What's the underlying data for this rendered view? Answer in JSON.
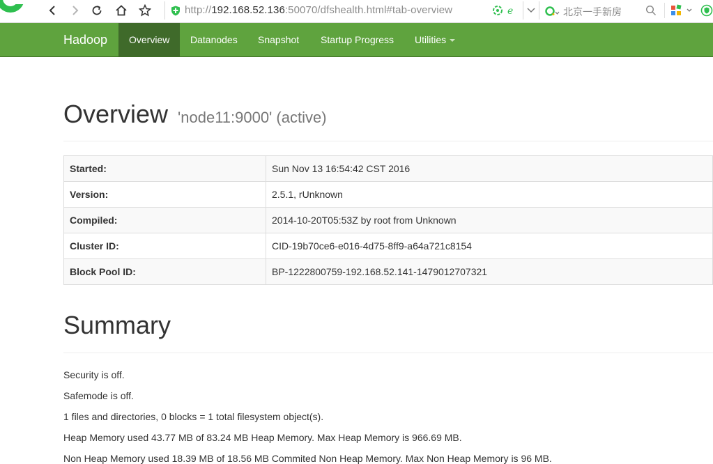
{
  "browser": {
    "url": {
      "scheme": "http://",
      "host": "192.168.52.136",
      "path": ":50070/dfshealth.html#tab-overview"
    },
    "search_placeholder": "北京一手新房",
    "accent_color": "#2fbf4f"
  },
  "navbar": {
    "brand": "Hadoop",
    "items": [
      {
        "label": "Overview",
        "active": true
      },
      {
        "label": "Datanodes"
      },
      {
        "label": "Snapshot"
      },
      {
        "label": "Startup Progress"
      },
      {
        "label": "Utilities",
        "has_dropdown": true
      }
    ],
    "color": "#5fa33e",
    "active_color": "#3f6a2a"
  },
  "overview": {
    "title": "Overview",
    "subtitle": "'node11:9000' (active)",
    "rows": [
      {
        "label": "Started:",
        "value": "Sun Nov 13 16:54:42 CST 2016"
      },
      {
        "label": "Version:",
        "value": "2.5.1, rUnknown"
      },
      {
        "label": "Compiled:",
        "value": "2014-10-20T05:53Z by root from Unknown"
      },
      {
        "label": "Cluster ID:",
        "value": "CID-19b70ce6-e016-4d75-8ff9-a64a721c8154"
      },
      {
        "label": "Block Pool ID:",
        "value": "BP-1222800759-192.168.52.141-1479012707321"
      }
    ]
  },
  "summary": {
    "title": "Summary",
    "lines": [
      "Security is off.",
      "Safemode is off.",
      "1 files and directories, 0 blocks = 1 total filesystem object(s).",
      "Heap Memory used 43.77 MB of 83.24 MB Heap Memory. Max Heap Memory is 966.69 MB.",
      "Non Heap Memory used 18.39 MB of 18.56 MB Commited Non Heap Memory. Max Non Heap Memory is 96 MB."
    ]
  }
}
